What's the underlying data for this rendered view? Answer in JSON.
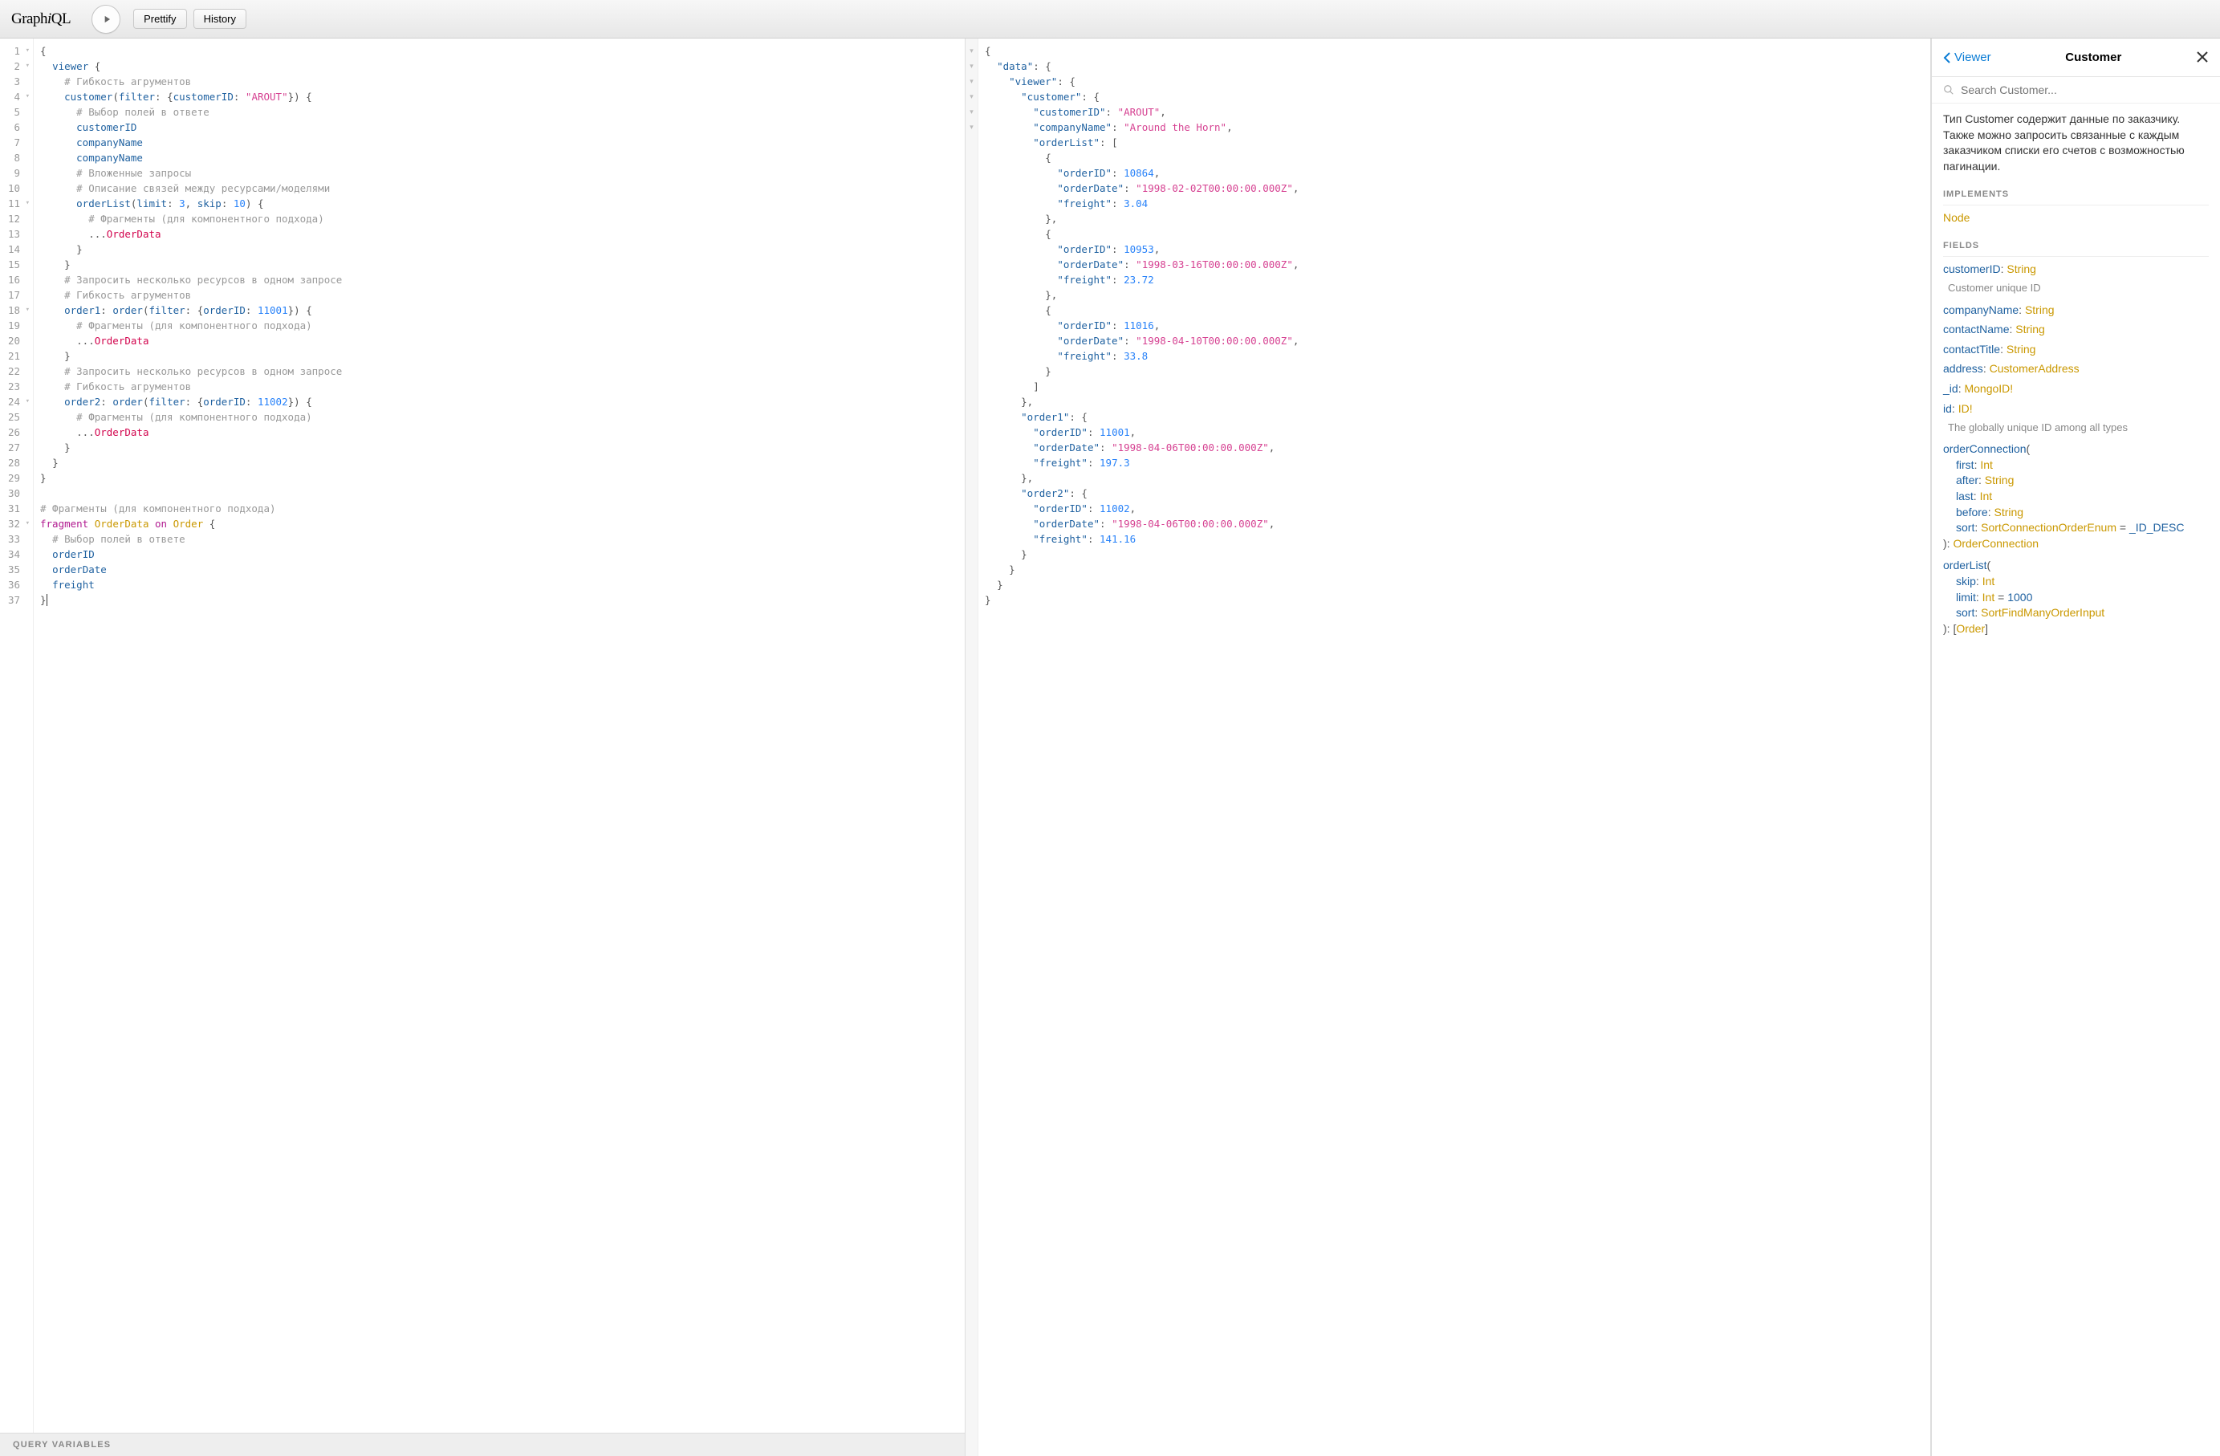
{
  "topbar": {
    "logo_html": "Graph<em>i</em>QL",
    "prettify": "Prettify",
    "history": "History"
  },
  "query_variables_label": "QUERY VARIABLES",
  "query": {
    "arg_customerID": "customerID",
    "arg_val_arout": "\"AROUT\"",
    "arg_orderID": "orderID",
    "arg_limit": "limit",
    "arg_skip": "skip",
    "num_3": "3",
    "num_10": "10",
    "num_11001": "11001",
    "num_11002": "11002",
    "field_viewer": "viewer",
    "field_customer": "customer",
    "field_customerID": "customerID",
    "field_companyName": "companyName",
    "field_orderList": "orderList",
    "alias_order1": "order1",
    "alias_order2": "order2",
    "field_order": "order",
    "field_orderID": "orderID",
    "field_orderDate": "orderDate",
    "field_freight": "freight",
    "frag_OrderData": "OrderData",
    "kw_fragment": "fragment",
    "kw_on": "on",
    "type_Order": "Order",
    "kw_filter": "filter",
    "c_flex_args": "# Гибкость агрументов",
    "c_select_fields": "# Выбор полей в ответе",
    "c_nested": "# Вложенные запросы",
    "c_relations": "# Описание связей между ресурсами/моделями",
    "c_fragments": "# Фрагменты (для компонентного подхода)",
    "c_multi": "# Запросить несколько ресурсов в одном запросе"
  },
  "response": {
    "k_data": "\"data\"",
    "k_viewer": "\"viewer\"",
    "k_customer": "\"customer\"",
    "k_customerID": "\"customerID\"",
    "k_companyName": "\"companyName\"",
    "k_orderList": "\"orderList\"",
    "k_orderID": "\"orderID\"",
    "k_orderDate": "\"orderDate\"",
    "k_freight": "\"freight\"",
    "k_order1": "\"order1\"",
    "k_order2": "\"order2\"",
    "v_AROUT": "\"AROUT\"",
    "v_AroundHorn": "\"Around the Horn\"",
    "n_10864": "10864",
    "d_1998_02_02": "\"1998-02-02T00:00:00.000Z\"",
    "f_3_04": "3.04",
    "n_10953": "10953",
    "d_1998_03_16": "\"1998-03-16T00:00:00.000Z\"",
    "f_23_72": "23.72",
    "n_11016": "11016",
    "d_1998_04_10": "\"1998-04-10T00:00:00.000Z\"",
    "f_33_8": "33.8",
    "n_11001": "11001",
    "d_1998_04_06": "\"1998-04-06T00:00:00.000Z\"",
    "f_197_3": "197.3",
    "n_11002": "11002",
    "f_141_16": "141.16"
  },
  "docs": {
    "back": "Viewer",
    "title": "Customer",
    "search_placeholder": "Search Customer...",
    "description": "Тип Customer содержит данные по заказчику. Также можно запросить связанные с каждым заказчиком списки его счетов с возможностью пагинации.",
    "implements_label": "IMPLEMENTS",
    "fields_label": "FIELDS",
    "implements_type": "Node",
    "field_customerID": "customerID",
    "field_customerID_desc": "Customer unique ID",
    "field_companyName": "companyName",
    "field_contactName": "contactName",
    "field_contactTitle": "contactTitle",
    "field_address": "address",
    "type_CustomerAddress": "CustomerAddress",
    "field__id": "_id",
    "type_MongoID_bang": "MongoID!",
    "field_id": "id",
    "type_ID_bang": "ID!",
    "field_id_desc": "The globally unique ID among all types",
    "type_String": "String",
    "field_orderConnection": "orderConnection",
    "arg_first": "first",
    "arg_after": "after",
    "arg_last": "last",
    "arg_before": "before",
    "arg_sort": "sort",
    "type_Int": "Int",
    "type_SortConnectionOrderEnum": "SortConnectionOrderEnum",
    "default__ID_DESC": "_ID_DESC",
    "type_OrderConnection": "OrderConnection",
    "field_orderList": "orderList",
    "arg_skip": "skip",
    "arg_limit": "limit",
    "val_1000": "1000",
    "type_SortFindManyOrderInput": "SortFindManyOrderInput",
    "type_Order_arr": "Order"
  }
}
